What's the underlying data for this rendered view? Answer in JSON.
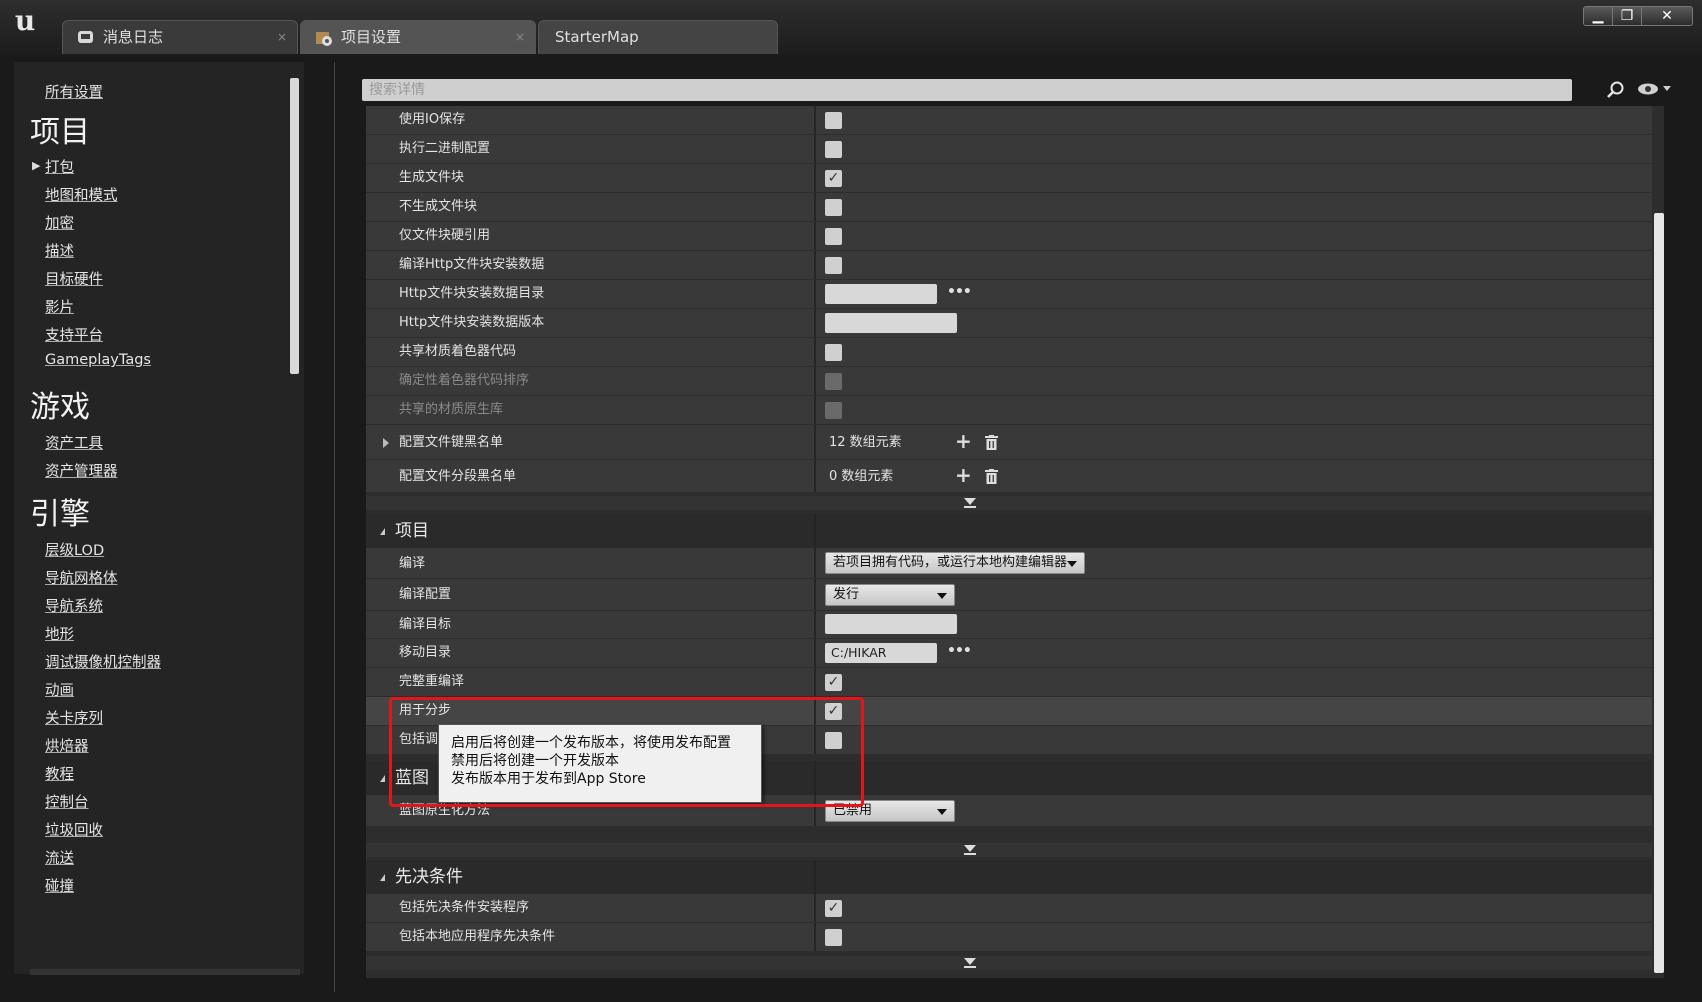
{
  "titlebar": {
    "tabs": [
      {
        "label": "消息日志",
        "icon": "message-log-icon"
      },
      {
        "label": "项目设置",
        "icon": "project-settings-icon"
      },
      {
        "label": "StarterMap"
      }
    ],
    "close_glyph": "×",
    "window_buttons": {
      "minimize": "▁",
      "maximize": "❐",
      "close": "✕"
    }
  },
  "sidebar": {
    "all_settings": "所有设置",
    "categories": [
      {
        "title": "项目",
        "items": [
          "打包",
          "地图和模式",
          "加密",
          "描述",
          "目标硬件",
          "影片",
          "支持平台",
          "GameplayTags"
        ]
      },
      {
        "title": "游戏",
        "items": [
          "资产工具",
          "资产管理器"
        ]
      },
      {
        "title": "引擎",
        "items": [
          "层级LOD",
          "导航网格体",
          "导航系统",
          "地形",
          "调试摄像机控制器",
          "动画",
          "关卡序列",
          "烘焙器",
          "教程",
          "控制台",
          "垃圾回收",
          "流送",
          "碰撞"
        ]
      }
    ]
  },
  "search": {
    "placeholder": "搜索详情"
  },
  "packaging_rows": [
    {
      "label": "使用IO保存",
      "checked": false
    },
    {
      "label": "执行二进制配置",
      "checked": false
    },
    {
      "label": "生成文件块",
      "checked": true
    },
    {
      "label": "不生成文件块",
      "checked": false
    },
    {
      "label": "仅文件块硬引用",
      "checked": false
    },
    {
      "label": "编译Http文件块安装数据",
      "checked": false
    },
    {
      "label": "Http文件块安装数据目录",
      "value": ""
    },
    {
      "label": "Http文件块安装数据版本",
      "value": ""
    },
    {
      "label": "共享材质着色器代码",
      "checked": false
    },
    {
      "label": "确定性着色器代码排序",
      "checked": false,
      "disabled": true
    },
    {
      "label": "共享的材质原生库",
      "checked": false,
      "disabled": true
    }
  ],
  "array_rows": [
    {
      "label": "配置文件键黑名单",
      "count": "12 数组元素"
    },
    {
      "label": "配置文件分段黑名单",
      "count": "0 数组元素"
    }
  ],
  "project_section": {
    "title": "项目",
    "build_label": "编译",
    "build_value": "若项目拥有代码，或运行本地构建编辑器",
    "build_config_label": "编译配置",
    "build_config_value": "发行",
    "build_target_label": "编译目标",
    "build_target_value": "",
    "staging_dir_label": "移动目录",
    "staging_dir_value": "C:/HIKAR",
    "full_rebuild_label": "完整重编译",
    "full_rebuild_checked": true,
    "for_distribution_label": "用于分步",
    "for_distribution_checked": true,
    "include_debug_label": "包括调",
    "include_debug_checked": false
  },
  "tooltip": {
    "lines": [
      "启用后将创建一个发布版本，将使用发布配置",
      "禁用后将创建一个开发版本",
      "发布版本用于发布到App Store"
    ]
  },
  "blueprint_section": {
    "title": "蓝图",
    "nativization_label": "蓝图原生化方法",
    "nativization_value": "已禁用"
  },
  "prereq_section": {
    "title": "先决条件",
    "rows": [
      {
        "label": "包括先决条件安装程序",
        "checked": true
      },
      {
        "label": "包括本地应用程序先决条件",
        "checked": false
      }
    ]
  },
  "ellipsis": "•••",
  "plus_glyph": "+",
  "checkmark": "✓",
  "colors": {
    "highlight_box": "#e0161b",
    "panel": "#393939",
    "tooltip_bg": "#f0f0f0"
  }
}
